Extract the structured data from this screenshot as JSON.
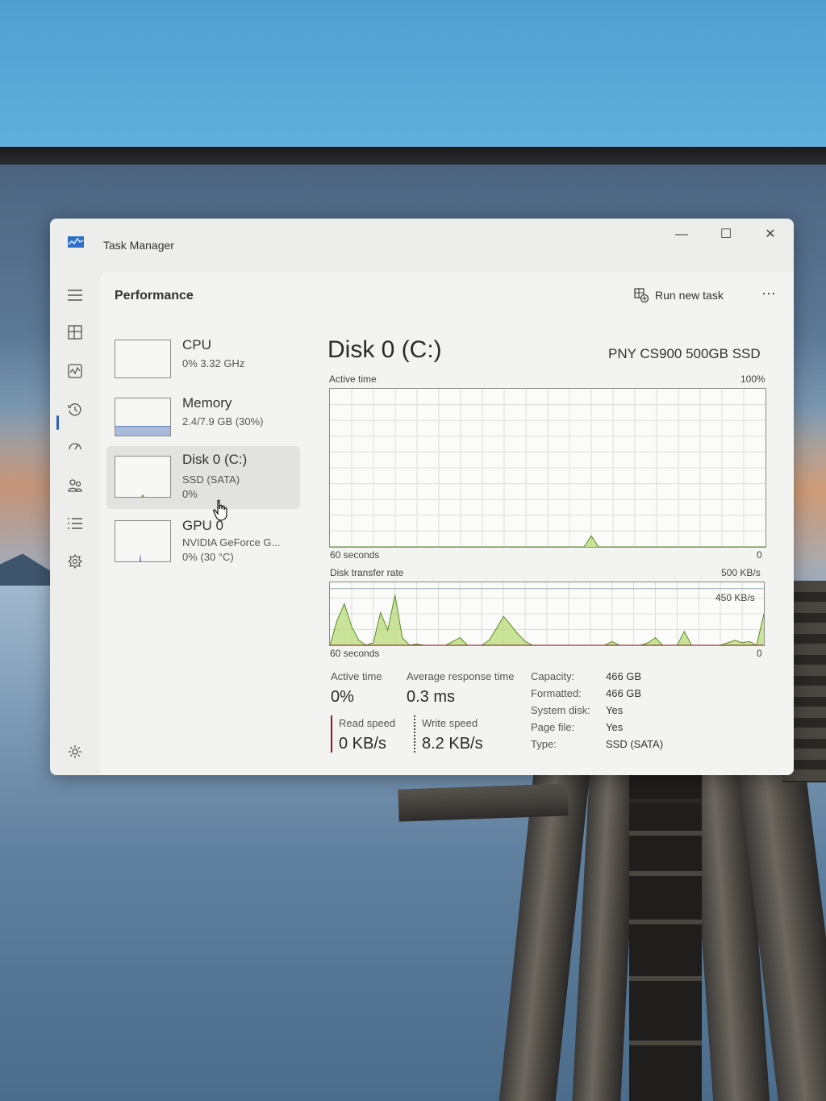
{
  "window": {
    "title": "Task Manager",
    "minimize_glyph": "—",
    "maximize_glyph": "☐",
    "close_glyph": "✕"
  },
  "nav": {
    "items": [
      {
        "icon": "hamburger-menu-icon"
      },
      {
        "icon": "processes-icon"
      },
      {
        "icon": "performance-icon",
        "selected": true
      },
      {
        "icon": "app-history-icon"
      },
      {
        "icon": "startup-apps-icon"
      },
      {
        "icon": "users-icon"
      },
      {
        "icon": "details-icon"
      },
      {
        "icon": "services-icon"
      }
    ],
    "settings_icon": "gear-icon",
    "accent": "#3060c0"
  },
  "header": {
    "title": "Performance",
    "run_new_task": "Run new task",
    "more": "···"
  },
  "devices": [
    {
      "name": "CPU",
      "line1": "0% 3.32 GHz",
      "line2": ""
    },
    {
      "name": "Memory",
      "line1": "2.4/7.9 GB (30%)",
      "line2": ""
    },
    {
      "name": "Disk 0 (C:)",
      "line1": "SSD (SATA)",
      "line2": "0%",
      "selected": true
    },
    {
      "name": "GPU 0",
      "line1": "NVIDIA GeForce G...",
      "line2": "0% (30 °C)"
    }
  ],
  "detail": {
    "title": "Disk 0 (C:)",
    "model": "PNY CS900 500GB SSD",
    "active_chart": {
      "label": "Active time",
      "max_label": "100%",
      "x_label": "60 seconds",
      "min_label": "0"
    },
    "transfer_chart": {
      "label": "Disk transfer rate",
      "max_label": "500 KB/s",
      "ref_label": "450 KB/s",
      "x_label": "60 seconds",
      "min_label": "0"
    },
    "stats": {
      "active_time_label": "Active time",
      "active_time_value": "0%",
      "avg_response_label": "Average response time",
      "avg_response_value": "0.3 ms",
      "read_label": "Read speed",
      "read_value": "0 KB/s",
      "write_label": "Write speed",
      "write_value": "8.2 KB/s"
    },
    "properties": [
      {
        "key": "Capacity:",
        "value": "466 GB"
      },
      {
        "key": "Formatted:",
        "value": "466 GB"
      },
      {
        "key": "System disk:",
        "value": "Yes"
      },
      {
        "key": "Page file:",
        "value": "Yes"
      },
      {
        "key": "Type:",
        "value": "SSD (SATA)"
      }
    ],
    "colors": {
      "graph_line": "#5a8a2a",
      "graph_fill": "#b8dc78",
      "read": "#8b1a1a",
      "grid": "#dcdcd8"
    }
  },
  "chart_data": [
    {
      "type": "area",
      "title": "Active time",
      "xlabel": "60 seconds",
      "ylabel": "",
      "xlim": [
        60,
        0
      ],
      "ylim": [
        0,
        100
      ],
      "series": [
        {
          "x": [
            60,
            50,
            40,
            30,
            25,
            24,
            23,
            22,
            10,
            0
          ],
          "values": [
            0,
            0,
            0,
            0,
            0,
            7,
            0,
            0,
            0,
            0
          ]
        }
      ]
    },
    {
      "type": "area",
      "title": "Disk transfer rate",
      "xlabel": "60 seconds",
      "ylabel": "",
      "xlim": [
        60,
        0
      ],
      "ylim": [
        0,
        500
      ],
      "reference_lines": [
        450
      ],
      "series": [
        {
          "name": "Write speed",
          "x": [
            60,
            59,
            58,
            57,
            56,
            55,
            54,
            53,
            52,
            51,
            50,
            49,
            48,
            47,
            46,
            45,
            44,
            43,
            42,
            41,
            40,
            39,
            38,
            37,
            36,
            35,
            34,
            33,
            32,
            31,
            30,
            29,
            28,
            27,
            26,
            25,
            24,
            23,
            22,
            21,
            20,
            19,
            18,
            17,
            16,
            15,
            14,
            13,
            12,
            11,
            10,
            9,
            8,
            7,
            6,
            5,
            4,
            3,
            2,
            1,
            0
          ],
          "values": [
            0,
            200,
            330,
            150,
            40,
            0,
            20,
            260,
            120,
            400,
            60,
            0,
            10,
            0,
            0,
            0,
            0,
            30,
            60,
            0,
            0,
            0,
            40,
            130,
            230,
            160,
            90,
            30,
            0,
            0,
            0,
            0,
            0,
            0,
            0,
            0,
            0,
            0,
            0,
            30,
            0,
            0,
            0,
            0,
            20,
            60,
            0,
            0,
            0,
            110,
            0,
            0,
            0,
            0,
            0,
            20,
            40,
            20,
            30,
            0,
            250
          ]
        },
        {
          "name": "Read speed",
          "x": [
            60,
            30,
            0
          ],
          "values": [
            0,
            0,
            0
          ]
        }
      ]
    }
  ]
}
